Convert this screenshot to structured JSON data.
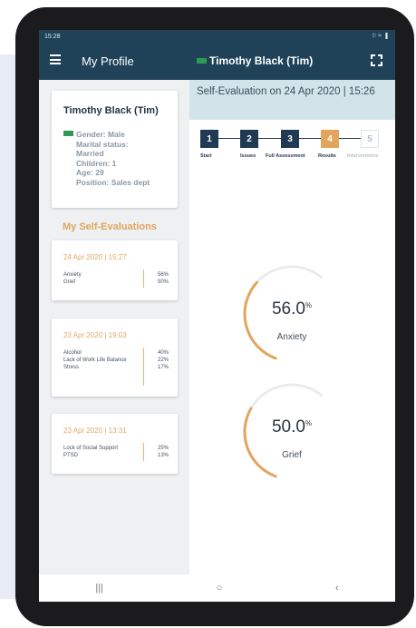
{
  "status_bar": {
    "time": "15:28",
    "right": "⯐ ≈ ▮"
  },
  "app_bar": {
    "title": "My Profile",
    "patient": "Timothy Black (Tim)"
  },
  "profile": {
    "name": "Timothy Black (Tim)",
    "gender": "Gender: Male",
    "marital_label": "Marital status:",
    "marital_value": "Married",
    "children": "Children: 1",
    "age": "Age: 29",
    "position": "Position: Sales dept"
  },
  "self_evaluations_title": "My Self-Evaluations",
  "evaluations": [
    {
      "date": "24 Apr 2020 | 15:27",
      "rows": [
        {
          "label": "Anxiety",
          "value": "56%"
        },
        {
          "label": "Grief",
          "value": "50%"
        }
      ]
    },
    {
      "date": "23 Apr 2020 | 19:03",
      "rows": [
        {
          "label": "Alcohol",
          "value": "40%"
        },
        {
          "label": "Lack of Work Life Balance",
          "value": "22%"
        },
        {
          "label": "Stress",
          "value": "17%"
        }
      ]
    },
    {
      "date": "23 Apr 2020 | 13:31",
      "rows": [
        {
          "label": "Lock of Social Support",
          "value": "25%"
        },
        {
          "label": "PTSD",
          "value": "13%"
        }
      ]
    }
  ],
  "evaluation_header": "Self-Evaluation on 24 Apr 2020 | 15:26",
  "steps": [
    {
      "num": "1",
      "label": "Start",
      "state": "done"
    },
    {
      "num": "2",
      "label": "Issues",
      "state": "done"
    },
    {
      "num": "3",
      "label": "Full Assessment",
      "state": "done"
    },
    {
      "num": "4",
      "label": "Results",
      "state": "active"
    },
    {
      "num": "5",
      "label": "Interventions",
      "state": "todo"
    }
  ],
  "results": [
    {
      "label": "Anxiety",
      "value_text": "56.0",
      "unit": "%",
      "percent": 56
    },
    {
      "label": "Grief",
      "value_text": "50.0",
      "unit": "%",
      "percent": 50
    }
  ],
  "colors": {
    "header": "#1f4258",
    "accent": "#e3a55e",
    "step_done": "#1f3a52"
  },
  "icons": {
    "menu": "hamburger-icon",
    "fullscreen": "fullscreen-icon",
    "next": "arrow-right-icon",
    "flag": "flag-icon"
  },
  "nav": {
    "recent": "|||",
    "home": "○",
    "back": "‹"
  }
}
